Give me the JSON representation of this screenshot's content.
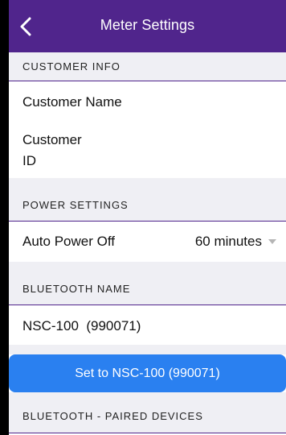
{
  "header": {
    "title": "Meter Settings",
    "back_icon": "chevron-left-icon"
  },
  "customer_info": {
    "section_label": "CUSTOMER INFO",
    "customer_name_label": "Customer Name",
    "customer_id_label_line1": "Customer",
    "customer_id_label_line2": "ID"
  },
  "power_settings": {
    "section_label": "POWER SETTINGS",
    "auto_power_off_label": "Auto Power Off",
    "auto_power_off_value": "60 minutes"
  },
  "bluetooth_name": {
    "section_label": "BLUETOOTH NAME",
    "current_name": "NSC-100  (990071)",
    "set_button_label": "Set to NSC-100 (990071)"
  },
  "paired_devices": {
    "section_label": "BLUETOOTH - PAIRED DEVICES"
  },
  "colors": {
    "accent": "#50258c",
    "button": "#2a80f0",
    "section_bg": "#efeff4"
  }
}
